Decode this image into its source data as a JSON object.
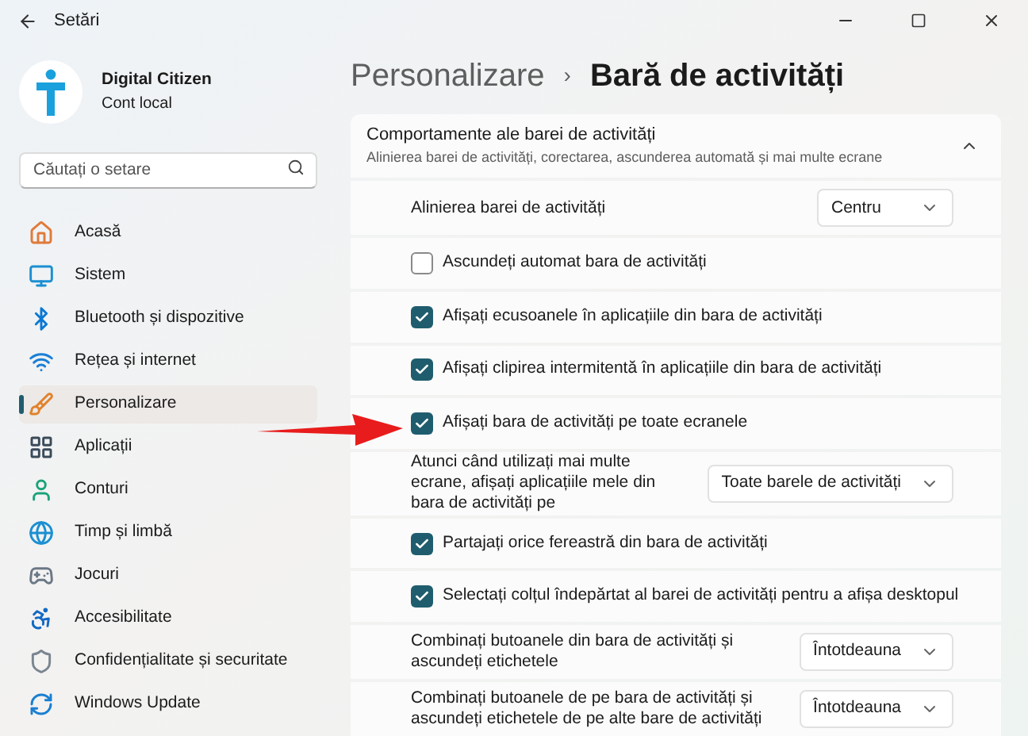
{
  "window": {
    "title": "Setări"
  },
  "account": {
    "name": "Digital Citizen",
    "type": "Cont local"
  },
  "search": {
    "placeholder": "Căutați o setare"
  },
  "sidebar": {
    "items": [
      {
        "label": "Acasă",
        "selected": false
      },
      {
        "label": "Sistem",
        "selected": false
      },
      {
        "label": "Bluetooth și dispozitive",
        "selected": false
      },
      {
        "label": "Rețea și internet",
        "selected": false
      },
      {
        "label": "Personalizare",
        "selected": true
      },
      {
        "label": "Aplicații",
        "selected": false
      },
      {
        "label": "Conturi",
        "selected": false
      },
      {
        "label": "Timp și limbă",
        "selected": false
      },
      {
        "label": "Jocuri",
        "selected": false
      },
      {
        "label": "Accesibilitate",
        "selected": false
      },
      {
        "label": "Confidențialitate și securitate",
        "selected": false
      },
      {
        "label": "Windows Update",
        "selected": false
      }
    ]
  },
  "breadcrumb": {
    "parent": "Personalizare",
    "separator": "›",
    "current": "Bară de activități"
  },
  "section": {
    "title": "Comportamente ale barei de activități",
    "subtitle": "Alinierea barei de activități, corectarea, ascunderea automată și mai multe ecrane",
    "expanded": true,
    "settings": [
      {
        "kind": "dropdown",
        "label": "Alinierea barei de activități",
        "value": "Centru"
      },
      {
        "kind": "checkbox",
        "label": "Ascundeți automat bara de activități",
        "checked": false
      },
      {
        "kind": "checkbox",
        "label": "Afișați ecusoanele în aplicațiile din bara de activități",
        "checked": true
      },
      {
        "kind": "checkbox",
        "label": "Afișați clipirea intermitentă în aplicațiile din bara de activități",
        "checked": true
      },
      {
        "kind": "checkbox",
        "label": "Afișați bara de activități pe toate ecranele",
        "checked": true
      },
      {
        "kind": "dropdown",
        "label": "Atunci când utilizați mai multe ecrane, afișați aplicațiile mele din bara de activități pe",
        "value": "Toate barele de activități"
      },
      {
        "kind": "checkbox",
        "label": "Partajați orice fereastră din bara de activități",
        "checked": true
      },
      {
        "kind": "checkbox",
        "label": "Selectați colțul îndepărtat al barei de activități pentru a afișa desktopul",
        "checked": true
      },
      {
        "kind": "dropdown",
        "label": "Combinați butoanele din bara de activități și ascundeți etichetele",
        "value": "Întotdeauna"
      },
      {
        "kind": "dropdown",
        "label": "Combinați butoanele de pe bara de activități și ascundeți etichetele de pe alte bare de activități",
        "value": "Întotdeauna"
      }
    ]
  }
}
